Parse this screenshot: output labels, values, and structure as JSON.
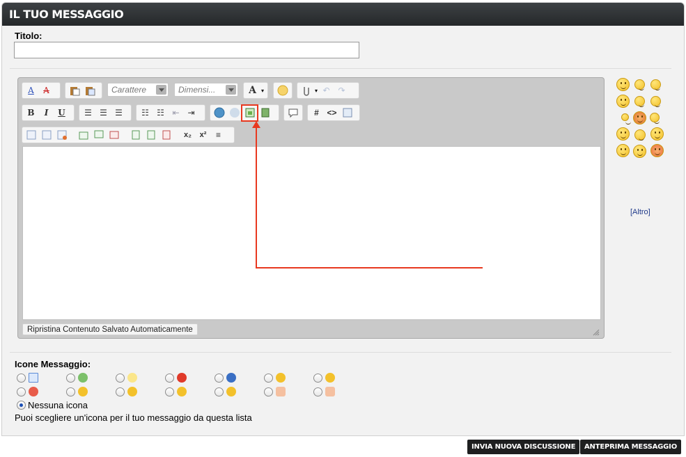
{
  "header": {
    "title": "IL TUO MESSAGGIO"
  },
  "form": {
    "title_label": "Titolo:",
    "title_value": "",
    "font_select": "Carattere",
    "size_select": "Dimensi...",
    "restore_label": "Ripristina Contenuto Salvato Automaticamente"
  },
  "smilies": {
    "more_label": "[Altro]"
  },
  "post_icons": {
    "label": "Icone Messaggio:",
    "none_label": "Nessuna icona",
    "hint": "Puoi scegliere un'icona per il tuo messaggio da questa lista",
    "selected": "Nessuna icona"
  },
  "buttons": {
    "submit": "INVIA NUOVA DISCUSSIONE",
    "preview": "ANTEPRIMA MESSAGGIO"
  },
  "colors": {
    "accent_annotation": "#e8381f",
    "header_bg": "#2b2e30",
    "link": "#1f3a8a"
  }
}
